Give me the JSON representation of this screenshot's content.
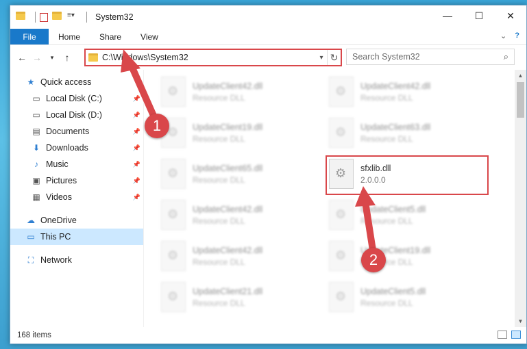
{
  "window": {
    "title": "System32"
  },
  "title_buttons": {
    "minimize": "—",
    "maximize": "☐",
    "close": "✕"
  },
  "ribbon": {
    "tabs": [
      "File",
      "Home",
      "Share",
      "View"
    ],
    "chevron": "⌄",
    "help": "?"
  },
  "address_bar": {
    "path": "C:\\Windows\\System32"
  },
  "search": {
    "placeholder": "Search System32"
  },
  "sidebar": {
    "items": [
      {
        "label": "Quick access",
        "icon": "star-icon"
      },
      {
        "label": "Local Disk (C:)",
        "icon": "drive-icon",
        "pinned": true
      },
      {
        "label": "Local Disk (D:)",
        "icon": "drive-icon",
        "pinned": true
      },
      {
        "label": "Documents",
        "icon": "document-icon",
        "pinned": true
      },
      {
        "label": "Downloads",
        "icon": "download-icon",
        "pinned": true
      },
      {
        "label": "Music",
        "icon": "music-icon",
        "pinned": true
      },
      {
        "label": "Pictures",
        "icon": "picture-icon",
        "pinned": true
      },
      {
        "label": "Videos",
        "icon": "video-icon",
        "pinned": true
      },
      {
        "label": "OneDrive",
        "icon": "cloud-icon"
      },
      {
        "label": "This PC",
        "icon": "computer-icon",
        "selected": true
      },
      {
        "label": "Network",
        "icon": "network-icon"
      }
    ]
  },
  "files": {
    "left": [
      {
        "name": "UpdateClient42.dll",
        "sub": "Resource DLL"
      },
      {
        "name": "UpdateClient19.dll",
        "sub": "Resource DLL"
      },
      {
        "name": "UpdateClient65.dll",
        "sub": "Resource DLL"
      },
      {
        "name": "UpdateClient42.dll",
        "sub": "Resource DLL"
      },
      {
        "name": "UpdateClient42.dll",
        "sub": "Resource DLL"
      },
      {
        "name": "UpdateClient21.dll",
        "sub": "Resource DLL"
      }
    ],
    "right": [
      {
        "name": "UpdateClient42.dll",
        "sub": "Resource DLL"
      },
      {
        "name": "UpdateClient63.dll",
        "sub": "Resource DLL"
      },
      {
        "name": "sfxlib.dll",
        "sub": "2.0.0.0",
        "highlighted": true
      },
      {
        "name": "UpdateClient5.dll",
        "sub": "Resource DLL"
      },
      {
        "name": "UpdateClient19.dll",
        "sub": "Resource DLL"
      },
      {
        "name": "UpdateClient5.dll",
        "sub": "Resource DLL"
      }
    ]
  },
  "status": {
    "items_count": "168 items"
  },
  "annotations": [
    {
      "number": "1",
      "color": "#d9474a"
    },
    {
      "number": "2",
      "color": "#d9474a"
    }
  ]
}
